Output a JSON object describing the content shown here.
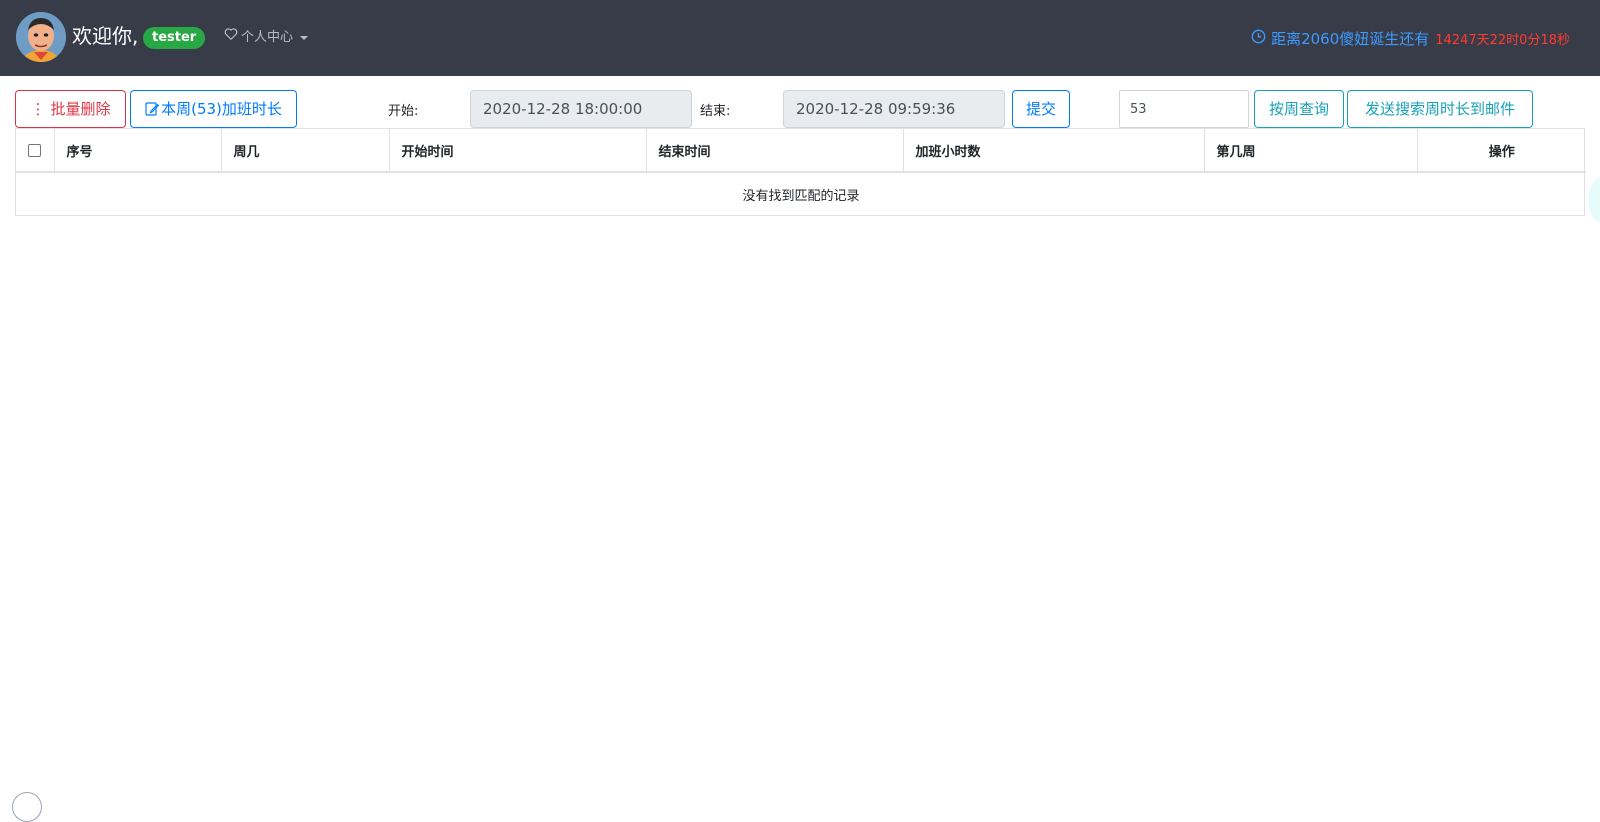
{
  "header": {
    "welcome_text": "欢迎你,",
    "username": "tester",
    "personal_center_label": "个人中心",
    "countdown_label": "距离2060傻妞诞生还有",
    "countdown_value": "14247天22时0分18秒",
    "colors": {
      "background": "#373c48",
      "badge": "#28a745",
      "countdown_label": "#3d9bff",
      "countdown_value": "#ff3b30"
    }
  },
  "toolbar": {
    "batch_delete_label": "批量删除",
    "week_overtime_label": "本周(53)加班时长",
    "start_label": "开始:",
    "start_value": "2020-12-28 18:00:00",
    "end_label": "结束:",
    "end_value": "2020-12-28 09:59:36",
    "submit_label": "提交",
    "week_value": "53",
    "query_week_label": "按周查询",
    "send_email_label": "发送搜索周时长到邮件"
  },
  "table": {
    "columns": [
      "序号",
      "周几",
      "开始时间",
      "结束时间",
      "加班小时数",
      "第几周",
      "操作"
    ],
    "rows": [],
    "empty_text": "没有找到匹配的记录"
  }
}
